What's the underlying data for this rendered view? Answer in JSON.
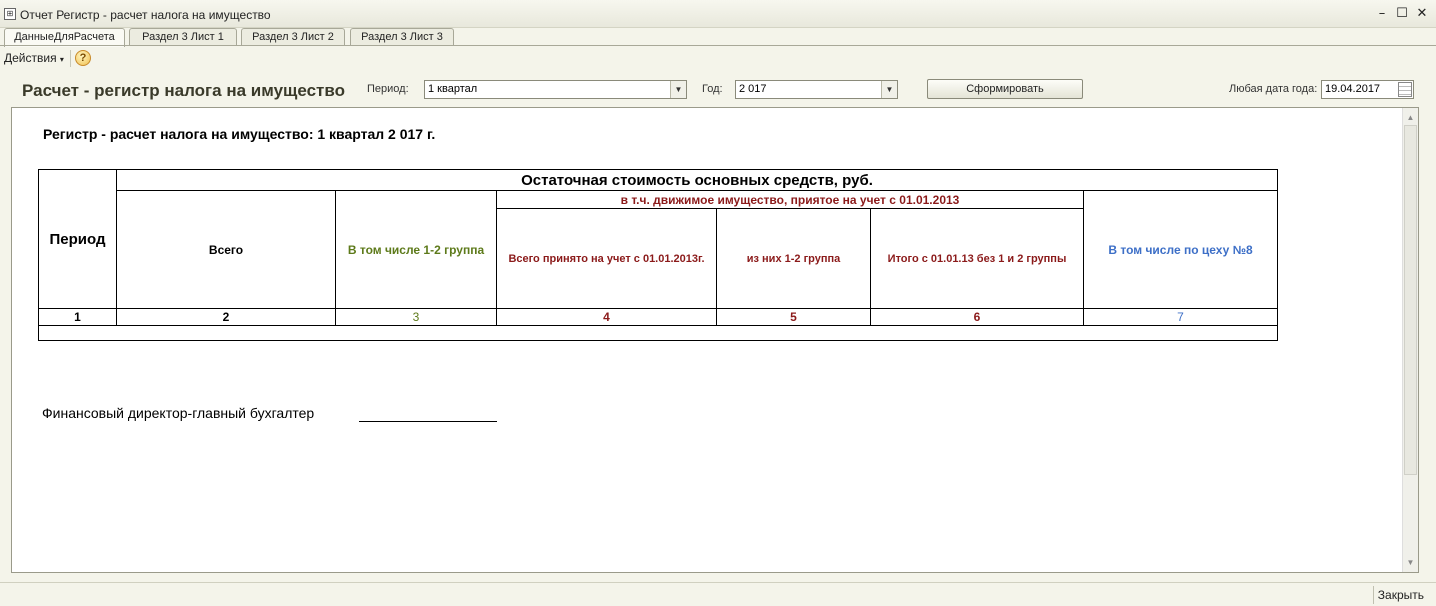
{
  "window": {
    "title": "Отчет  Регистр - расчет налога на имущество"
  },
  "tabs": [
    {
      "label": "ДанныеДляРасчета",
      "active": true
    },
    {
      "label": "Раздел 3 Лист 1",
      "active": false
    },
    {
      "label": "Раздел 3 Лист 2",
      "active": false
    },
    {
      "label": "Раздел 3 Лист 3",
      "active": false
    }
  ],
  "toolbar": {
    "actions_label": "Действия",
    "help_label": "?"
  },
  "form": {
    "title": "Расчет - регистр налога на имущество",
    "period_label": "Период:",
    "period_value": "1 квартал",
    "year_label": "Год:",
    "year_value": "2 017",
    "generate_label": "Сформировать",
    "any_date_label": "Любая дата года:",
    "any_date_value": "19.04.2017"
  },
  "report": {
    "heading": "Регистр - расчет налога на имущество: 1 квартал 2 017 г.",
    "table": {
      "period_header": "Период",
      "residual_header": "Остаточная стоимость основных средств, руб.",
      "total_header": "Всего",
      "group12_header": "В том числе 1-2 группа",
      "movable_header": "в т.ч. движимое имущество, приятое на учет с 01.01.2013",
      "accepted_total_header": "Всего принято на учет с 01.01.2013г.",
      "of_them_group12_header": "из них 1-2 группа",
      "total_excl_header": "Итого с 01.01.13 без 1 и 2 группы",
      "shop8_header": "В том числе по цеху №8",
      "column_numbers": [
        "1",
        "2",
        "3",
        "4",
        "5",
        "6",
        "7"
      ]
    },
    "signature_label": "Финансовый директор-главный бухгалтер"
  },
  "statusbar": {
    "close_label": "Закрыть"
  },
  "colors": {
    "olive": "#5d7a1a",
    "maroon": "#8b1a1a",
    "blue": "#3d6fc7"
  }
}
